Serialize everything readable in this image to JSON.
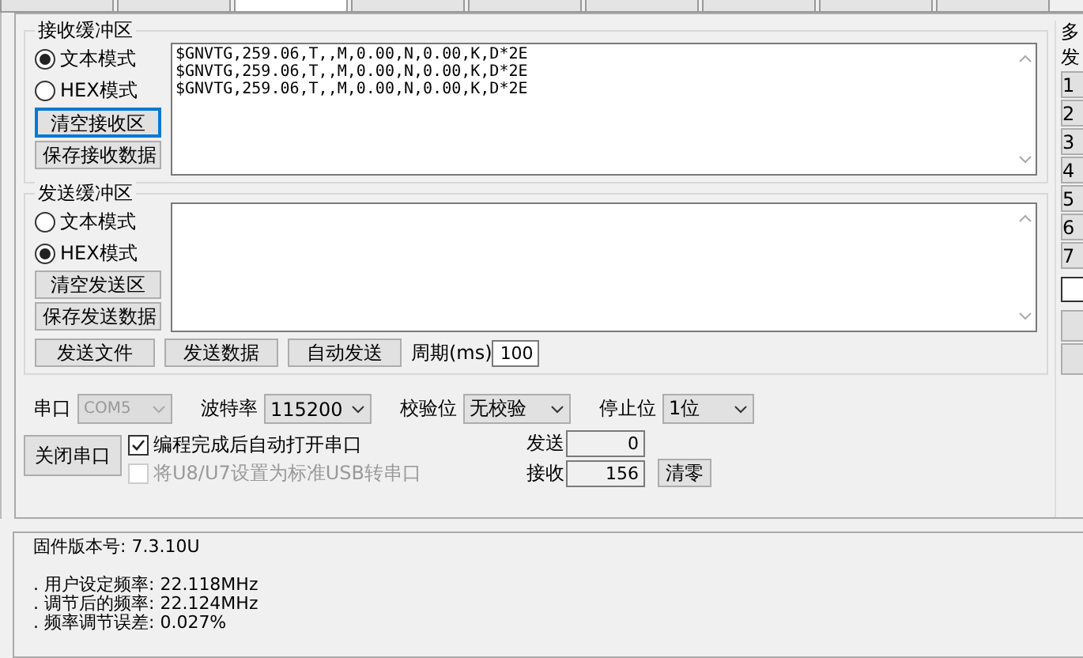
{
  "tabs": [
    {
      "selected": false
    },
    {
      "selected": false
    },
    {
      "selected": true
    },
    {
      "selected": false
    },
    {
      "selected": false
    },
    {
      "selected": false
    },
    {
      "selected": false
    },
    {
      "selected": false
    },
    {
      "selected": false
    }
  ],
  "receive": {
    "title": "接收缓冲区",
    "modes": [
      {
        "label": "文本模式",
        "selected": true
      },
      {
        "label": "HEX模式",
        "selected": false
      }
    ],
    "buttons": [
      {
        "label": "清空接收区",
        "focused": true
      },
      {
        "label": "保存接收数据",
        "focused": false
      }
    ],
    "lines": [
      "$GNVTG,259.06,T,,M,0.00,N,0.00,K,D*2E",
      "$GNVTG,259.06,T,,M,0.00,N,0.00,K,D*2E",
      "$GNVTG,259.06,T,,M,0.00,N,0.00,K,D*2E"
    ]
  },
  "send": {
    "title": "发送缓冲区",
    "modes": [
      {
        "label": "文本模式",
        "selected": false
      },
      {
        "label": "HEX模式",
        "selected": true
      }
    ],
    "buttons": [
      {
        "label": "清空发送区",
        "focused": false
      },
      {
        "label": "保存发送数据",
        "focused": false
      }
    ],
    "actions": [
      "发送文件",
      "发送数据",
      "自动发送"
    ],
    "period_label": "周期(ms)",
    "period": "100"
  },
  "serial": {
    "port_label": "串口",
    "port": "COM5",
    "port_disabled": true,
    "baud_label": "波特率",
    "baud": "115200",
    "parity_label": "校验位",
    "parity": "无校验",
    "stop_label": "停止位",
    "stop": "1位"
  },
  "close_button": "关闭串口",
  "options": [
    {
      "label": "编程完成后自动打开串口",
      "checked": true,
      "disabled": false
    },
    {
      "label": "将U8/U7设置为标准USB转串口",
      "checked": false,
      "disabled": true
    }
  ],
  "counters": [
    {
      "label": "发送",
      "value": "0"
    },
    {
      "label": "接收",
      "value": "156"
    }
  ],
  "clear_button": "清零",
  "side": {
    "label_1": "多",
    "label_2": "发",
    "keys": [
      "1",
      "2",
      "3",
      "4",
      "5",
      "6",
      "7"
    ],
    "checked": false
  },
  "log": [
    "固件版本号: 7.3.10U",
    ". 用户设定频率: 22.118MHz",
    ". 调节后的频率: 22.124MHz",
    ". 频率调节误差: 0.027%"
  ]
}
